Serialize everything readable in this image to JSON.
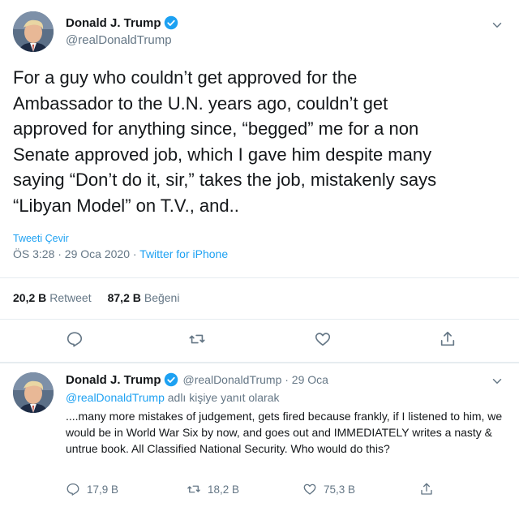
{
  "main_tweet": {
    "display_name": "Donald J. Trump",
    "handle": "@realDonaldTrump",
    "text": "For a guy who couldn’t get approved for the\nAmbassador to the U.N. years ago, couldn’t get\napproved for anything since, “begged” me for a non\nSenate approved job, which I gave him despite many\nsaying “Don’t do it, sir,” takes the job, mistakenly says\n“Libyan Model” on T.V., and..",
    "translate_label": "Tweeti Çevir",
    "timestamp": "ÖS 3:28 · 29 Oca 2020 · ",
    "source": "Twitter for iPhone",
    "retweet_count": "20,2 B",
    "retweet_label": "Retweet",
    "like_count": "87,2 B",
    "like_label": "Beğeni"
  },
  "reply_tweet": {
    "display_name": "Donald J. Trump",
    "handle_time": "@realDonaldTrump · 29 Oca",
    "reply_mention": "@realDonaldTrump",
    "reply_suffix": " adlı kişiye yanıt olarak",
    "text": "....many more mistakes of judgement, gets fired because frankly, if I listened to him, we would be in World War Six by now, and goes out and IMMEDIATELY writes a nasty & untrue book. All Classified National Security. Who would do this?",
    "reply_count": "17,9 B",
    "retweet_count": "18,2 B",
    "like_count": "75,3 B"
  },
  "icons": {
    "verified": "verified-badge-icon",
    "reply": "reply-icon",
    "retweet": "retweet-icon",
    "like": "heart-icon",
    "share": "share-icon",
    "more": "chevron-down-icon"
  },
  "colors": {
    "accent": "#1da1f2",
    "secondary_text": "#657786",
    "primary_text": "#14171a",
    "divider": "#e6ecf0"
  }
}
